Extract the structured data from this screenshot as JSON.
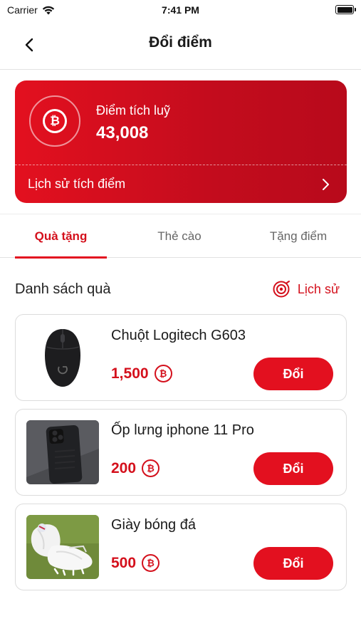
{
  "status_bar": {
    "carrier": "Carrier",
    "time": "7:41 PM"
  },
  "nav": {
    "title": "Đổi điểm"
  },
  "points": {
    "label": "Điểm tích luỹ",
    "value": "43,008",
    "coin_symbol": "₿",
    "history_label": "Lịch sử tích điểm"
  },
  "tabs": [
    {
      "label": "Quà tặng",
      "active": true
    },
    {
      "label": "Thẻ cào",
      "active": false
    },
    {
      "label": "Tặng điểm",
      "active": false
    }
  ],
  "gifts_section": {
    "title": "Danh sách quà",
    "history_label": "Lịch sử"
  },
  "gifts": [
    {
      "name": "Chuột Logitech G603",
      "price": "1,500",
      "coin_symbol": "₿",
      "button_label": "Đổi",
      "image_icon": "mouse"
    },
    {
      "name": "Ốp lưng iphone 11 Pro",
      "price": "200",
      "coin_symbol": "₿",
      "button_label": "Đổi",
      "image_icon": "phone-case"
    },
    {
      "name": "Giày bóng đá",
      "price": "500",
      "coin_symbol": "₿",
      "button_label": "Đổi",
      "image_icon": "football-boots"
    }
  ],
  "colors": {
    "accent": "#e3101f",
    "accent_dark": "#b80a1b",
    "text_red": "#d4101c"
  }
}
